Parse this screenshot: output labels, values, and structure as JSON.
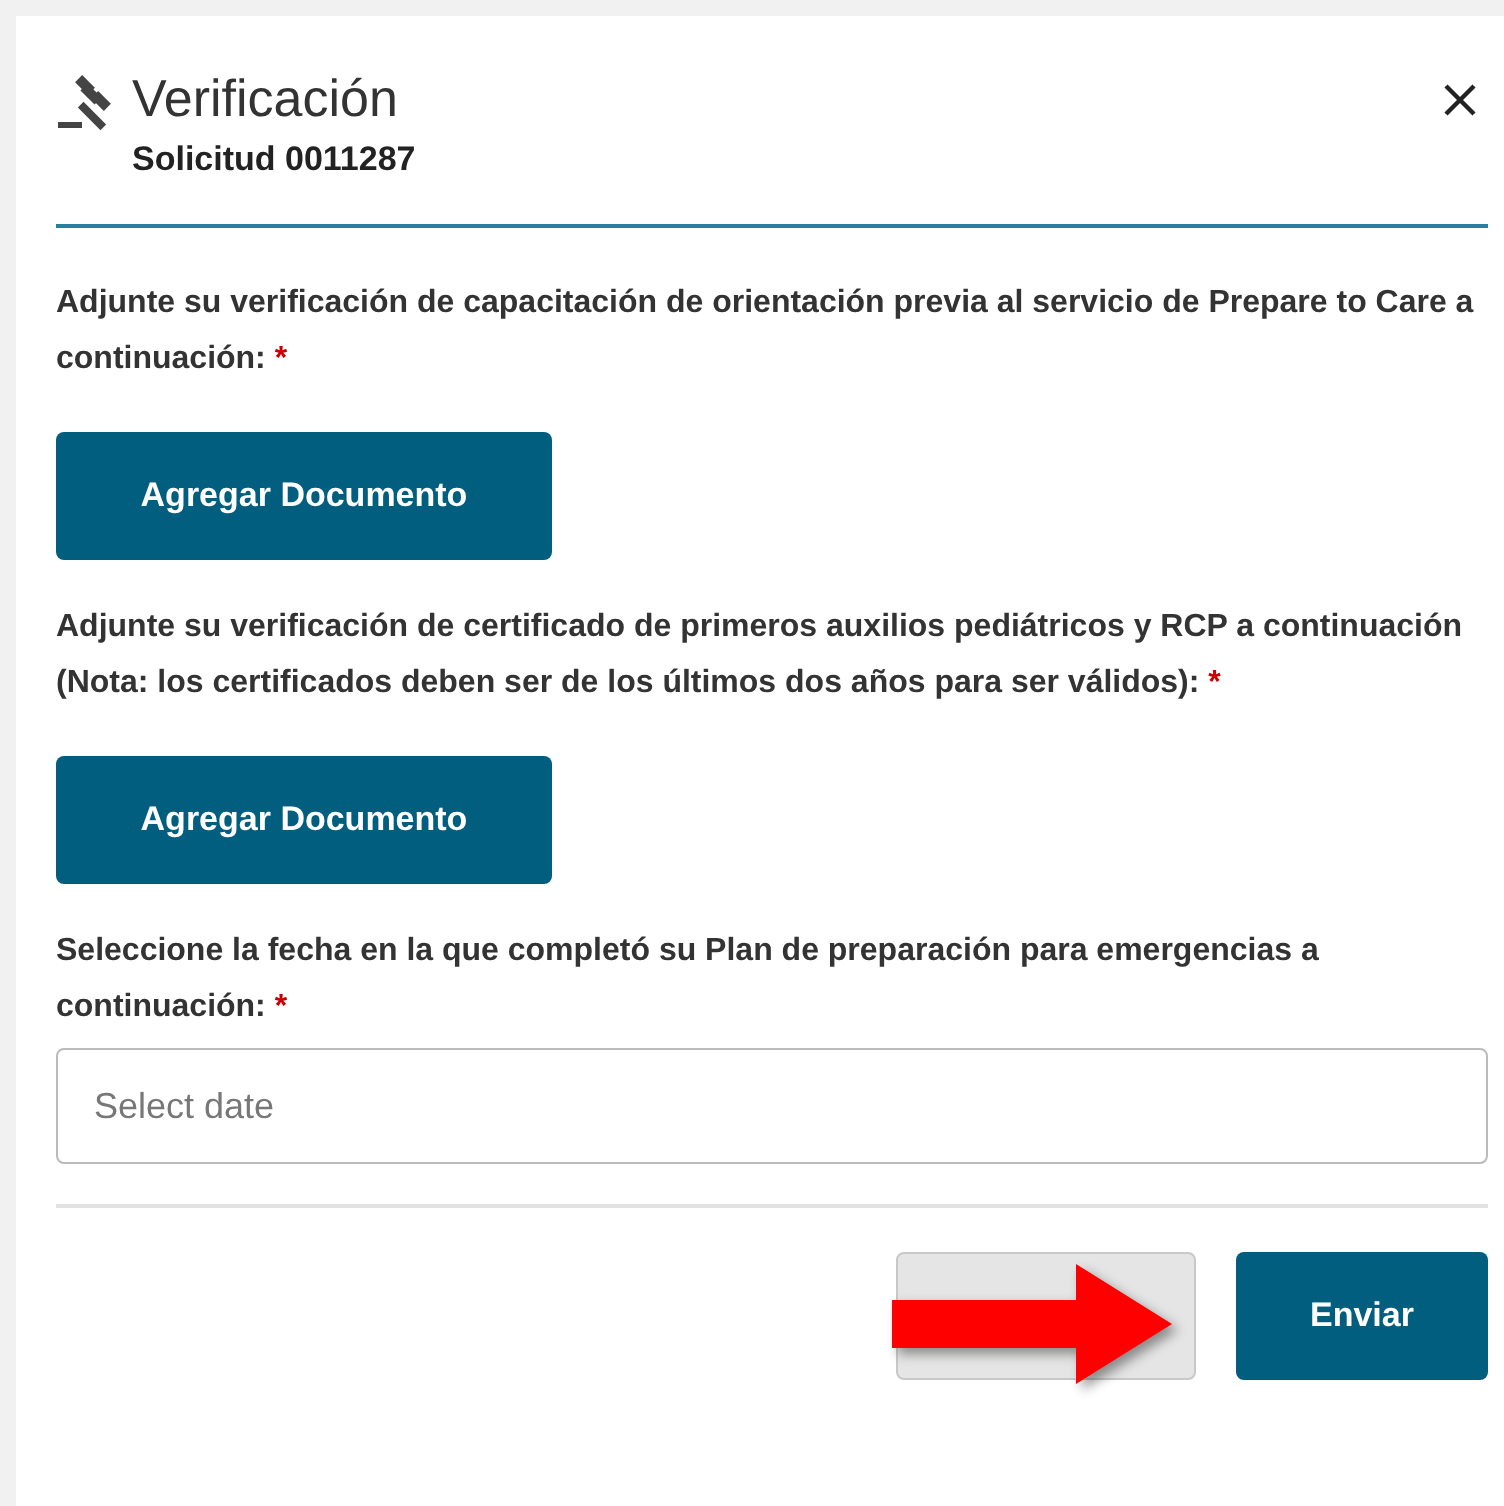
{
  "dialog": {
    "title": "Verificación",
    "subtitle": "Solicitud 0011287"
  },
  "fields": [
    {
      "kind": "upload",
      "label": "Adjunte su verificación de capacitación de orientación previa al servicio de Prepare to Care a continuación:",
      "required_mark": "*",
      "button": "Agregar Documento"
    },
    {
      "kind": "upload",
      "label": "Adjunte su verificación de certificado de primeros auxilios pediátricos y RCP a continuación (Nota: los certificados deben ser de los últimos dos años para ser válidos):",
      "required_mark": "*",
      "button": "Agregar Documento"
    },
    {
      "kind": "date",
      "label": "Seleccione la fecha en la que completó su Plan de preparación para emergencias a continuación:",
      "required_mark": "*",
      "placeholder": "Select date"
    }
  ],
  "footer": {
    "buttons": [
      {
        "kind": "secondary"
      },
      {
        "kind": "primary",
        "label": "Enviar"
      }
    ]
  }
}
